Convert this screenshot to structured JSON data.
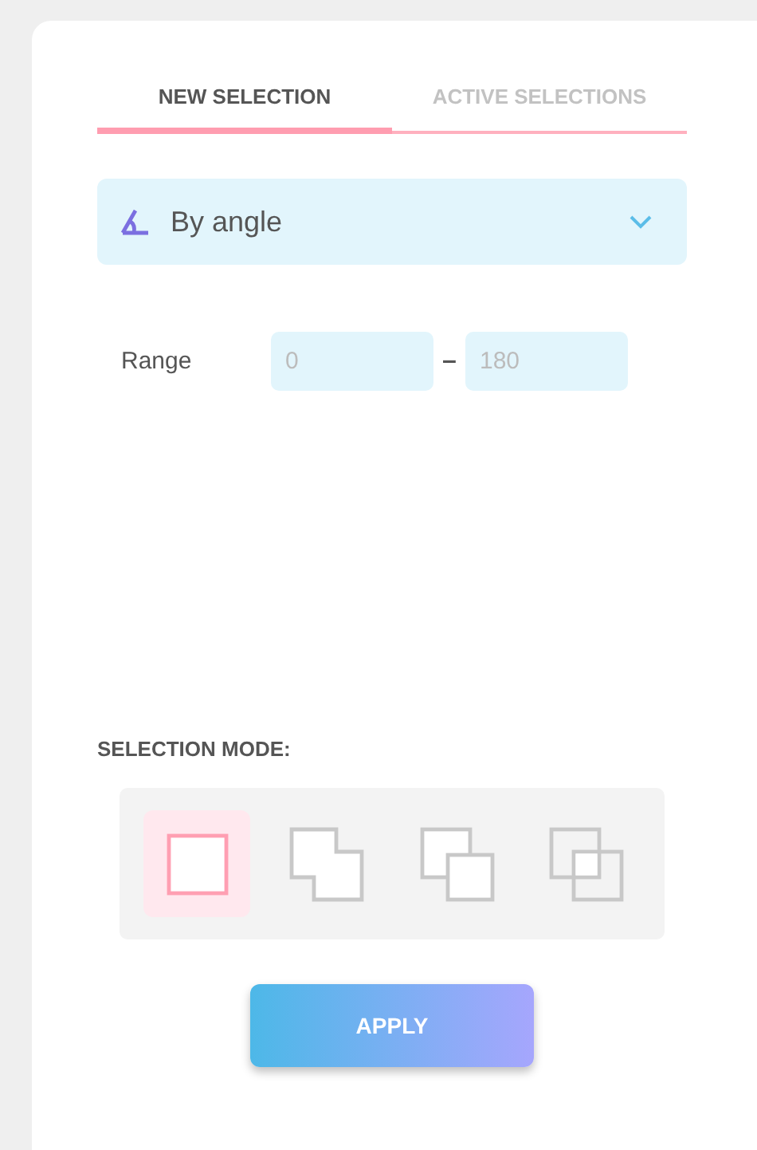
{
  "tabs": [
    {
      "label": "NEW SELECTION",
      "selected": true
    },
    {
      "label": "ACTIVE SELECTIONS",
      "selected": false
    }
  ],
  "dropdown": {
    "value": "By angle"
  },
  "range": {
    "label": "Range",
    "min": {
      "placeholder": "0"
    },
    "separator": "–",
    "max": {
      "placeholder": "180"
    }
  },
  "selection_mode": {
    "label": "SELECTION MODE:",
    "modes": [
      {
        "kind": "new",
        "selected": true
      },
      {
        "kind": "add",
        "selected": false
      },
      {
        "kind": "subtract",
        "selected": false
      },
      {
        "kind": "intersect",
        "selected": false
      }
    ]
  },
  "buttons": [
    {
      "label": "APPLY"
    }
  ]
}
